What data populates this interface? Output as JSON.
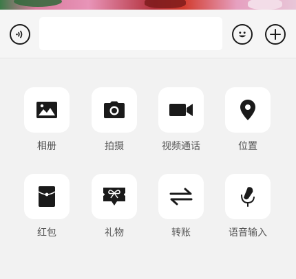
{
  "input_bar": {
    "voice_icon": "voice-mode-icon",
    "message_value": "",
    "emoji_icon": "emoji-icon",
    "plus_icon": "plus-icon"
  },
  "panel": {
    "items": [
      {
        "label": "相册",
        "icon": "photo-album-icon"
      },
      {
        "label": "拍摄",
        "icon": "camera-icon"
      },
      {
        "label": "视频通话",
        "icon": "video-call-icon"
      },
      {
        "label": "位置",
        "icon": "location-pin-icon"
      },
      {
        "label": "红包",
        "icon": "red-packet-icon"
      },
      {
        "label": "礼物",
        "icon": "gift-icon"
      },
      {
        "label": "转账",
        "icon": "transfer-icon"
      },
      {
        "label": "语音输入",
        "icon": "voice-input-icon"
      }
    ]
  },
  "colors": {
    "icon": "#1a1a1a",
    "tile_background": "#ffffff",
    "panel_background": "#f2f2f2",
    "label_text": "#555555"
  }
}
